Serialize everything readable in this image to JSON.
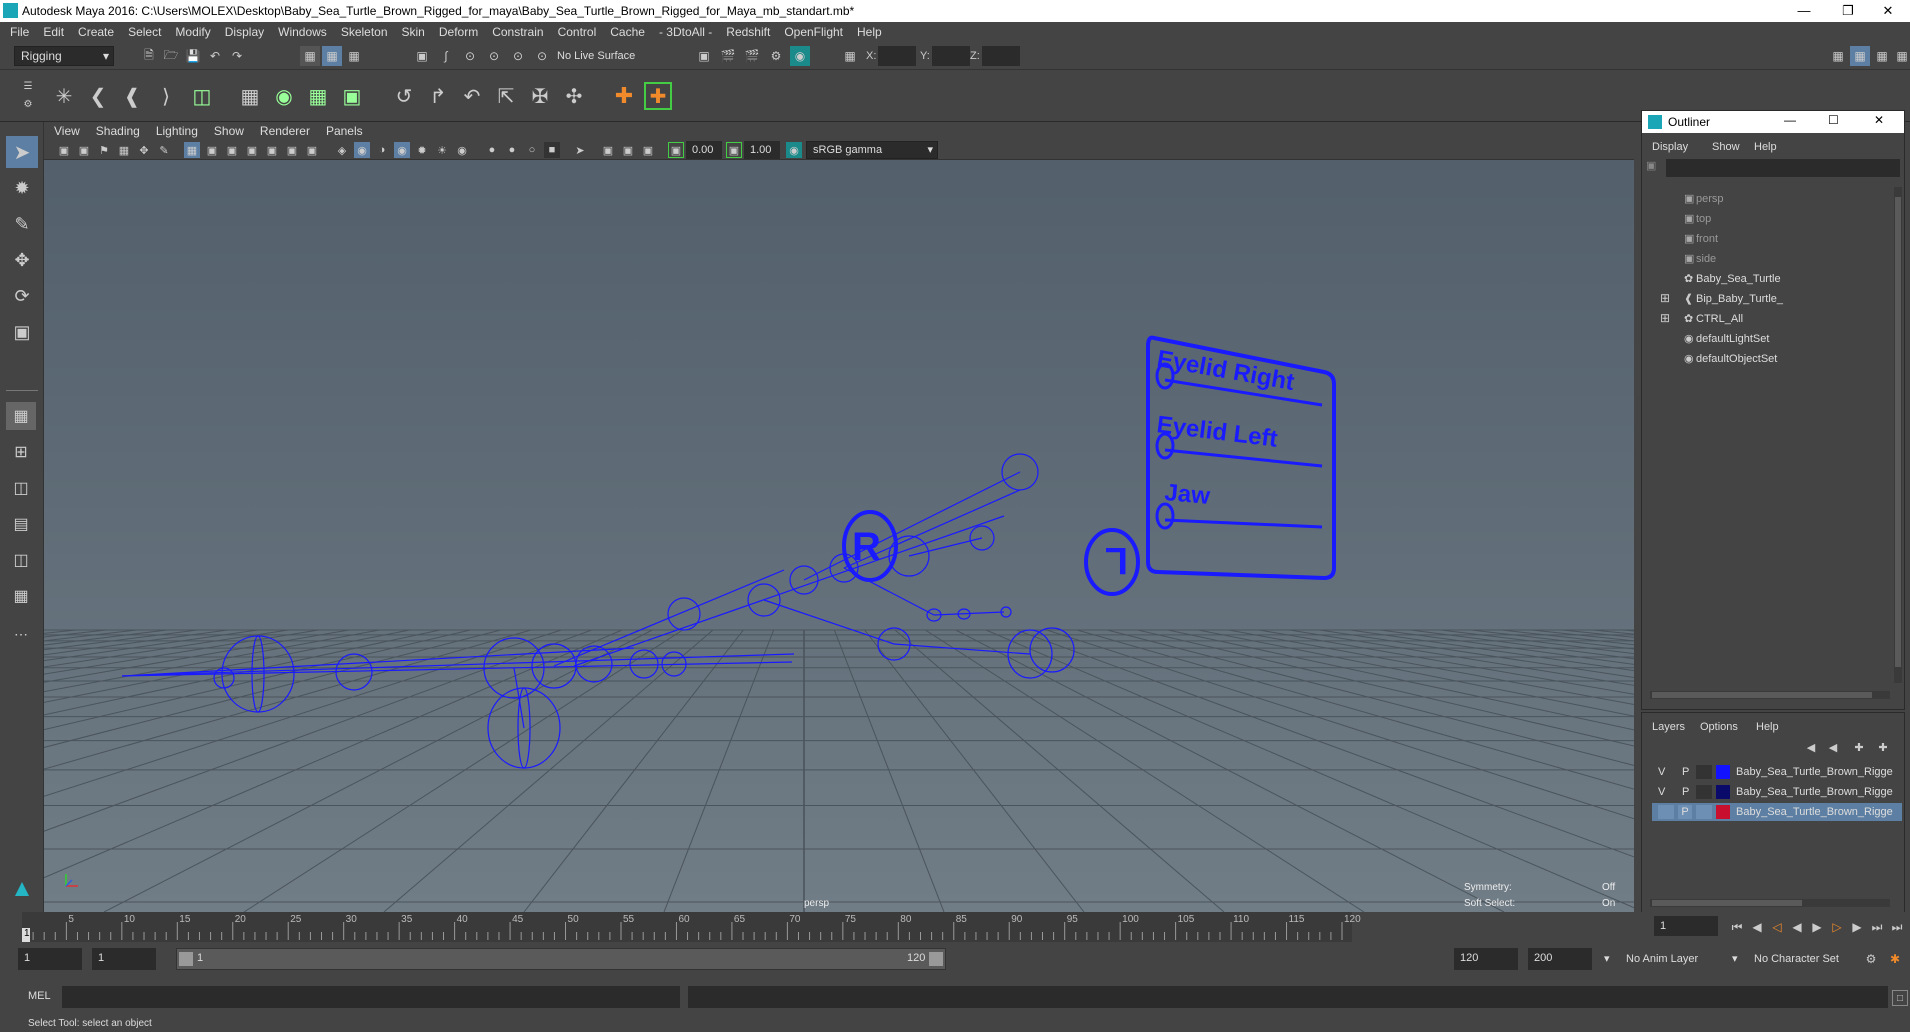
{
  "app": {
    "title": "Autodesk Maya 2016: C:\\Users\\MOLEX\\Desktop\\Baby_Sea_Turtle_Brown_Rigged_for_maya\\Baby_Sea_Turtle_Brown_Rigged_for_Maya_mb_standart.mb*"
  },
  "menubar": [
    "File",
    "Edit",
    "Create",
    "Select",
    "Modify",
    "Display",
    "Windows",
    "Skeleton",
    "Skin",
    "Deform",
    "Constrain",
    "Control",
    "Cache",
    "- 3DtoAll -",
    "Redshift",
    "OpenFlight",
    "Help"
  ],
  "statusline": {
    "mode": "Rigging",
    "live_surface": "No Live Surface",
    "x_label": "X:",
    "y_label": "Y:",
    "z_label": "Z:"
  },
  "viewport_menu": [
    "View",
    "Shading",
    "Lighting",
    "Show",
    "Renderer",
    "Panels"
  ],
  "viewport_toolbar": {
    "exposure": "0.00",
    "gamma": "1.00",
    "color_space": "sRGB gamma"
  },
  "viewport": {
    "camera_label": "persp",
    "hud": {
      "symmetry_label": "Symmetry:",
      "symmetry_value": "Off",
      "soft_select_label": "Soft Select:",
      "soft_select_value": "On"
    },
    "controls": {
      "eyelid_right": "Eyelid Right",
      "eyelid_left": "Eyelid Left",
      "jaw": "Jaw",
      "right_marker": "R",
      "left_marker": "L"
    },
    "rig_color": "#1a1aff"
  },
  "outliner": {
    "title": "Outliner",
    "menu": [
      "Display",
      "Show",
      "Help"
    ],
    "items": [
      {
        "label": "persp",
        "icon": "camera-icon",
        "dim": true,
        "expand": false
      },
      {
        "label": "top",
        "icon": "camera-icon",
        "dim": true,
        "expand": false
      },
      {
        "label": "front",
        "icon": "camera-icon",
        "dim": true,
        "expand": false
      },
      {
        "label": "side",
        "icon": "camera-icon",
        "dim": true,
        "expand": false
      },
      {
        "label": "Baby_Sea_Turtle",
        "icon": "transform-icon",
        "dim": false,
        "expand": false
      },
      {
        "label": "Bip_Baby_Turtle_",
        "icon": "joint-icon",
        "dim": false,
        "expand": true
      },
      {
        "label": "CTRL_All",
        "icon": "transform-icon",
        "dim": false,
        "expand": true
      },
      {
        "label": "defaultLightSet",
        "icon": "set-icon",
        "dim": false,
        "expand": false
      },
      {
        "label": "defaultObjectSet",
        "icon": "set-icon",
        "dim": false,
        "expand": false
      }
    ]
  },
  "layers": {
    "menu": [
      "Layers",
      "Options",
      "Help"
    ],
    "rows": [
      {
        "v": "V",
        "p": "P",
        "color": "#1212ff",
        "name": "Baby_Sea_Turtle_Brown_Rigge",
        "selected": false
      },
      {
        "v": "V",
        "p": "P",
        "color": "#0a0a6a",
        "name": "Baby_Sea_Turtle_Brown_Rigge",
        "selected": false
      },
      {
        "v": "",
        "p": "P",
        "color": "#c8102e",
        "name": "Baby_Sea_Turtle_Brown_Rigge",
        "selected": true
      }
    ]
  },
  "timeline": {
    "ticks": [
      "5",
      "10",
      "15",
      "20",
      "25",
      "30",
      "35",
      "40",
      "45",
      "50",
      "55",
      "60",
      "65",
      "70",
      "75",
      "80",
      "85",
      "90",
      "95",
      "100",
      "105",
      "110",
      "115",
      "120"
    ],
    "start_label": "1",
    "current_frame": "1"
  },
  "range": {
    "start": "1",
    "anim_start": "1",
    "slider_start": "1",
    "slider_end": "120",
    "range_end": "120",
    "anim_end": "200",
    "anim_layer": "No Anim Layer",
    "character_set": "No Character Set"
  },
  "cmdline": {
    "label": "MEL"
  },
  "helpline": {
    "text": "Select Tool: select an object"
  }
}
